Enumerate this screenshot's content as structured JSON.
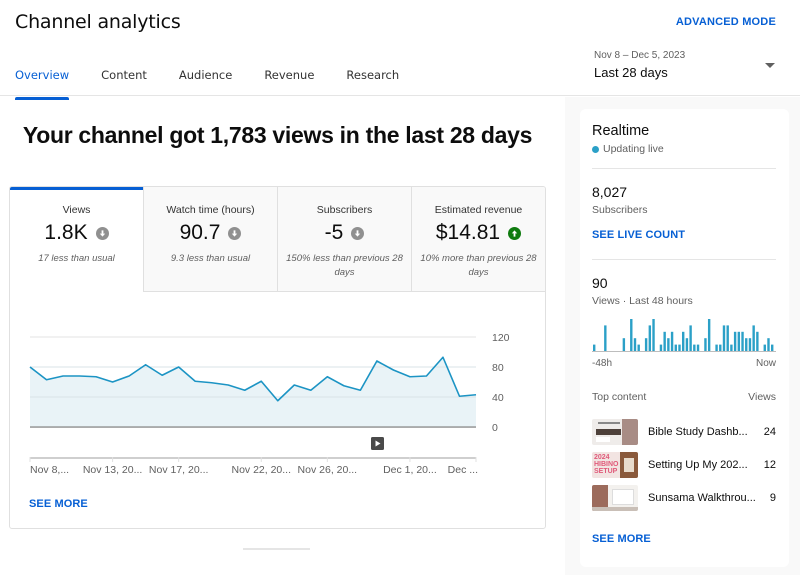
{
  "header": {
    "title": "Channel analytics",
    "advanced_mode": "ADVANCED MODE",
    "tabs": [
      {
        "label": "Overview",
        "active": true
      },
      {
        "label": "Content",
        "active": false
      },
      {
        "label": "Audience",
        "active": false
      },
      {
        "label": "Revenue",
        "active": false
      },
      {
        "label": "Research",
        "active": false
      }
    ],
    "date_range": {
      "sub": "Nov 8 – Dec 5, 2023",
      "main": "Last 28 days",
      "icon": "caret-down-icon"
    }
  },
  "headline": "Your channel got 1,783 views in the last 28 days",
  "metrics": [
    {
      "label": "Views",
      "value": "1.8K",
      "trend": "down",
      "note": "17 less than usual",
      "active": true
    },
    {
      "label": "Watch time (hours)",
      "value": "90.7",
      "trend": "down",
      "note": "9.3 less than usual",
      "active": false
    },
    {
      "label": "Subscribers",
      "value": "-5",
      "trend": "down",
      "note": "150% less than previous 28 days",
      "active": false
    },
    {
      "label": "Estimated revenue",
      "value": "$14.81",
      "trend": "up",
      "note": "10% more than previous 28 days",
      "active": false
    }
  ],
  "colors": {
    "accent": "#065fd4",
    "line": "#1c94c4",
    "area": "#e9f3f7",
    "trend_down": "#909090",
    "trend_up": "#0f7b0f",
    "live": "#2ba0c7"
  },
  "chart_data": {
    "type": "area",
    "title": "Views",
    "x": [
      "Nov 8",
      "Nov 9",
      "Nov 10",
      "Nov 11",
      "Nov 12",
      "Nov 13",
      "Nov 14",
      "Nov 15",
      "Nov 16",
      "Nov 17",
      "Nov 18",
      "Nov 19",
      "Nov 20",
      "Nov 21",
      "Nov 22",
      "Nov 23",
      "Nov 24",
      "Nov 25",
      "Nov 26",
      "Nov 27",
      "Nov 28",
      "Nov 29",
      "Nov 30",
      "Dec 1",
      "Dec 2",
      "Dec 3",
      "Dec 4",
      "Dec 5"
    ],
    "values": [
      80,
      63,
      68,
      68,
      67,
      60,
      68,
      83,
      69,
      80,
      61,
      59,
      56,
      49,
      61,
      35,
      56,
      49,
      67,
      55,
      49,
      88,
      76,
      67,
      68,
      93,
      41,
      43
    ],
    "x_tick_labels": [
      {
        "index": 0,
        "label": "Nov 8,..."
      },
      {
        "index": 5,
        "label": "Nov 13, 20..."
      },
      {
        "index": 9,
        "label": "Nov 17, 20..."
      },
      {
        "index": 14,
        "label": "Nov 22, 20..."
      },
      {
        "index": 18,
        "label": "Nov 26, 20..."
      },
      {
        "index": 23,
        "label": "Dec 1, 20..."
      },
      {
        "index": 27,
        "label": "Dec ..."
      }
    ],
    "y_ticks": [
      0,
      40,
      80,
      120
    ],
    "ylim": [
      0,
      120
    ],
    "y_axis_side": "right",
    "grid": true,
    "xlabel": "",
    "ylabel": ""
  },
  "see_more": "SEE MORE",
  "realtime": {
    "title": "Realtime",
    "status": "Updating live",
    "subscribers_value": "8,027",
    "subscribers_label": "Subscribers",
    "see_live_count": "SEE LIVE COUNT",
    "views_value": "90",
    "views_label": "Views · Last 48 hours",
    "axis_start": "-48h",
    "axis_end": "Now",
    "hourly_views": [
      1,
      0,
      0,
      4,
      0,
      0,
      0,
      0,
      2,
      0,
      5,
      2,
      1,
      0,
      2,
      4,
      5,
      0,
      1,
      3,
      2,
      3,
      1,
      1,
      3,
      2,
      4,
      1,
      1,
      0,
      2,
      5,
      0,
      1,
      1,
      4,
      4,
      1,
      3,
      3,
      3,
      2,
      2,
      4,
      3,
      0,
      1,
      2,
      1
    ],
    "top_content_label": "Top content",
    "top_views_label": "Views",
    "top_content": [
      {
        "title": "Bible Study Dashb...",
        "views": "24",
        "thumb": "bible-study-thumbnail"
      },
      {
        "title": "Setting Up My 202...",
        "views": "12",
        "thumb": "hibino-setup-thumbnail"
      },
      {
        "title": "Sunsama Walkthrou...",
        "views": "9",
        "thumb": "sunsama-thumbnail"
      }
    ],
    "see_more": "SEE MORE"
  }
}
